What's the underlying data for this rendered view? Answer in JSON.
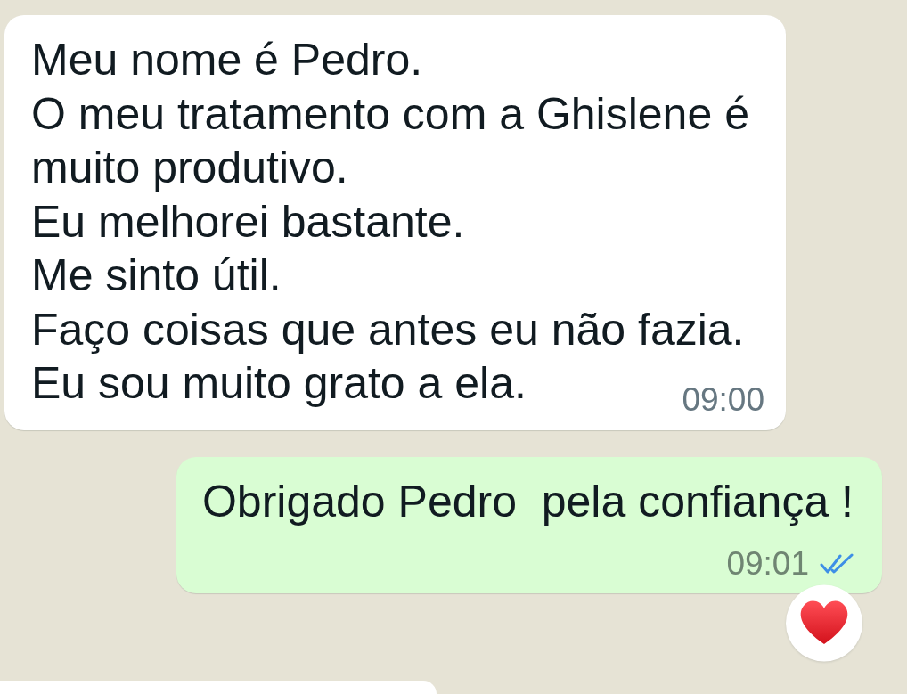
{
  "messages": [
    {
      "kind": "incoming",
      "lines": [
        "Meu nome é Pedro.",
        "O meu tratamento com a Ghislene é muito produtivo.",
        "Eu melhorei bastante.",
        "Me sinto útil.",
        "Faço coisas que antes eu não fazia.",
        "Eu sou muito grato a ela."
      ],
      "time": "09:00"
    },
    {
      "kind": "outgoing",
      "lines": [
        "Obrigado Pedro  pela confiança !"
      ],
      "time": "09:01",
      "read": true,
      "reaction": {
        "kind": "heart"
      }
    },
    {
      "kind": "incoming"
    }
  ]
}
